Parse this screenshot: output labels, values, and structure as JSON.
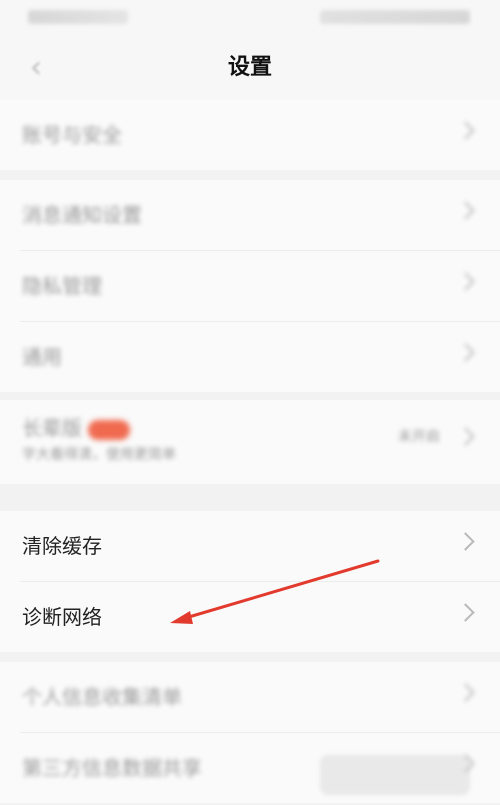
{
  "header": {
    "title": "设置"
  },
  "sections": [
    {
      "items": [
        {
          "label": "账号与安全"
        }
      ]
    },
    {
      "items": [
        {
          "label": "消息通知设置"
        },
        {
          "label": "隐私管理"
        },
        {
          "label": "通用"
        }
      ]
    },
    {
      "items": [
        {
          "label": "长辈版",
          "subtitle": "字大看得清，使用更简单",
          "value": "未开启"
        }
      ]
    },
    {
      "items": [
        {
          "label": "清除缓存"
        },
        {
          "label": "诊断网络"
        }
      ]
    },
    {
      "items": [
        {
          "label": "个人信息收集清单"
        },
        {
          "label": "第三方信息数据共享"
        }
      ]
    }
  ],
  "colors": {
    "accent": "#f06a4f",
    "annotation_arrow": "#e23b2e"
  }
}
